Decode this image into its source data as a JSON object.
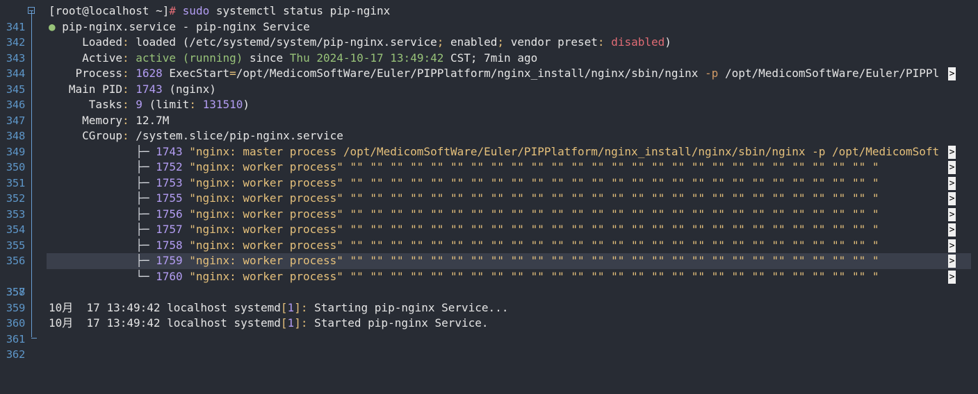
{
  "gutter": {
    "line_numbers": [
      "341",
      "342",
      "343",
      "344",
      "345",
      "346",
      "347",
      "348",
      "349",
      "350",
      "351",
      "352",
      "353",
      "354",
      "355",
      "356",
      "357",
      "358",
      "359",
      "360",
      "361",
      "362"
    ]
  },
  "prompt": {
    "user_host": "[root@localhost ~]",
    "hash": "#",
    "command_sudo": "sudo",
    "command_rest": " systemctl status pip-nginx"
  },
  "service": {
    "bullet": "●",
    "name": " pip-nginx.service",
    "dash": " - ",
    "description": "pip-nginx Service"
  },
  "loaded": {
    "label": "     Loaded",
    "colon": ": ",
    "state": "loaded",
    "paren_open": " (",
    "path": "/etc/systemd/system/pip-nginx.service",
    "semi1": "; ",
    "enabled": "enabled",
    "semi2": "; ",
    "vendor_label": "vendor preset",
    "vendor_colon": ": ",
    "vendor_value": "disabled",
    "paren_close": ")"
  },
  "active": {
    "label": "     Active",
    "colon": ": ",
    "state": "active (running)",
    "since": " since ",
    "date": "Thu 2024-10-17 13:49:42",
    "tz": " CST; 7min ago"
  },
  "process": {
    "label": "    Process",
    "colon": ": ",
    "pid": "1628",
    "exec_label": " ExecStart",
    "exec_eq": "=",
    "exec_path": "/opt/MedicomSoftWare/Euler/PIPPlatform/nginx_install/nginx/sbin/nginx",
    "flag": " -p",
    "rest": " /opt/MedicomSoftWare/Euler/PIPPl"
  },
  "main_pid": {
    "label": "   Main PID",
    "colon": ": ",
    "pid": "1743",
    "name": " (nginx)"
  },
  "tasks": {
    "label": "      Tasks",
    "colon": ": ",
    "value": "9",
    "limit_label": " (limit",
    "limit_colon": ": ",
    "limit_value": "131510",
    "close": ")"
  },
  "memory": {
    "label": "     Memory",
    "colon": ": ",
    "value": "12.7M"
  },
  "cgroup": {
    "label": "     CGroup",
    "colon": ": ",
    "value": "/system.slice/pip-nginx.service"
  },
  "tree": [
    {
      "branch": "             ├─ ",
      "pid": "1743",
      "text": " \"nginx: master process /opt/MedicomSoftWare/Euler/PIPPlatform/nginx_install/nginx/sbin/nginx -p /opt/MedicomSoft",
      "quotes": ""
    },
    {
      "branch": "             ├─ ",
      "pid": "1752",
      "text": " \"nginx: worker process\"",
      "quotes": " \"\" \"\" \"\" \"\" \"\" \"\" \"\" \"\" \"\" \"\" \"\" \"\" \"\" \"\" \"\" \"\" \"\" \"\" \"\" \"\" \"\" \"\" \"\" \"\" \"\" \"\" \""
    },
    {
      "branch": "             ├─ ",
      "pid": "1753",
      "text": " \"nginx: worker process\"",
      "quotes": " \"\" \"\" \"\" \"\" \"\" \"\" \"\" \"\" \"\" \"\" \"\" \"\" \"\" \"\" \"\" \"\" \"\" \"\" \"\" \"\" \"\" \"\" \"\" \"\" \"\" \"\" \""
    },
    {
      "branch": "             ├─ ",
      "pid": "1755",
      "text": " \"nginx: worker process\"",
      "quotes": " \"\" \"\" \"\" \"\" \"\" \"\" \"\" \"\" \"\" \"\" \"\" \"\" \"\" \"\" \"\" \"\" \"\" \"\" \"\" \"\" \"\" \"\" \"\" \"\" \"\" \"\" \""
    },
    {
      "branch": "             ├─ ",
      "pid": "1756",
      "text": " \"nginx: worker process\"",
      "quotes": " \"\" \"\" \"\" \"\" \"\" \"\" \"\" \"\" \"\" \"\" \"\" \"\" \"\" \"\" \"\" \"\" \"\" \"\" \"\" \"\" \"\" \"\" \"\" \"\" \"\" \"\" \""
    },
    {
      "branch": "             ├─ ",
      "pid": "1757",
      "text": " \"nginx: worker process\"",
      "quotes": " \"\" \"\" \"\" \"\" \"\" \"\" \"\" \"\" \"\" \"\" \"\" \"\" \"\" \"\" \"\" \"\" \"\" \"\" \"\" \"\" \"\" \"\" \"\" \"\" \"\" \"\" \""
    },
    {
      "branch": "             ├─ ",
      "pid": "1758",
      "text": " \"nginx: worker process\"",
      "quotes": " \"\" \"\" \"\" \"\" \"\" \"\" \"\" \"\" \"\" \"\" \"\" \"\" \"\" \"\" \"\" \"\" \"\" \"\" \"\" \"\" \"\" \"\" \"\" \"\" \"\" \"\" \""
    },
    {
      "branch": "             ├─ ",
      "pid": "1759",
      "text": " \"nginx: worker process\"",
      "quotes": " \"\" \"\" \"\" \"\" \"\" \"\" \"\" \"\" \"\" \"\" \"\" \"\" \"\" \"\" \"\" \"\" \"\" \"\" \"\" \"\" \"\" \"\" \"\" \"\" \"\" \"\" \""
    },
    {
      "branch": "             └─ ",
      "pid": "1760",
      "text": " \"nginx: worker process\"",
      "quotes": " \"\" \"\" \"\" \"\" \"\" \"\" \"\" \"\" \"\" \"\" \"\" \"\" \"\" \"\" \"\" \"\" \"\" \"\" \"\" \"\" \"\" \"\" \"\" \"\" \"\" \"\" \""
    }
  ],
  "truncation_marker": ">",
  "log": [
    {
      "month": "10月",
      "day": "  17 13:49:42",
      "host": " localhost systemd",
      "bracket_open": "[",
      "pid": "1",
      "bracket_close": "]",
      "colon": ":",
      "message": " Starting pip-nginx Service..."
    },
    {
      "month": "10月",
      "day": "  17 13:49:42",
      "host": " localhost systemd",
      "bracket_open": "[",
      "pid": "1",
      "bracket_close": "]",
      "colon": ":",
      "message": " Started pip-nginx Service."
    }
  ],
  "colors": {
    "background": "#282c34",
    "current_line": "#3a3f4b",
    "gutter_text": "#5e96c8",
    "green": "#98c379",
    "red": "#e06c75",
    "yellow": "#e5c07b",
    "purple": "#b39df3"
  }
}
